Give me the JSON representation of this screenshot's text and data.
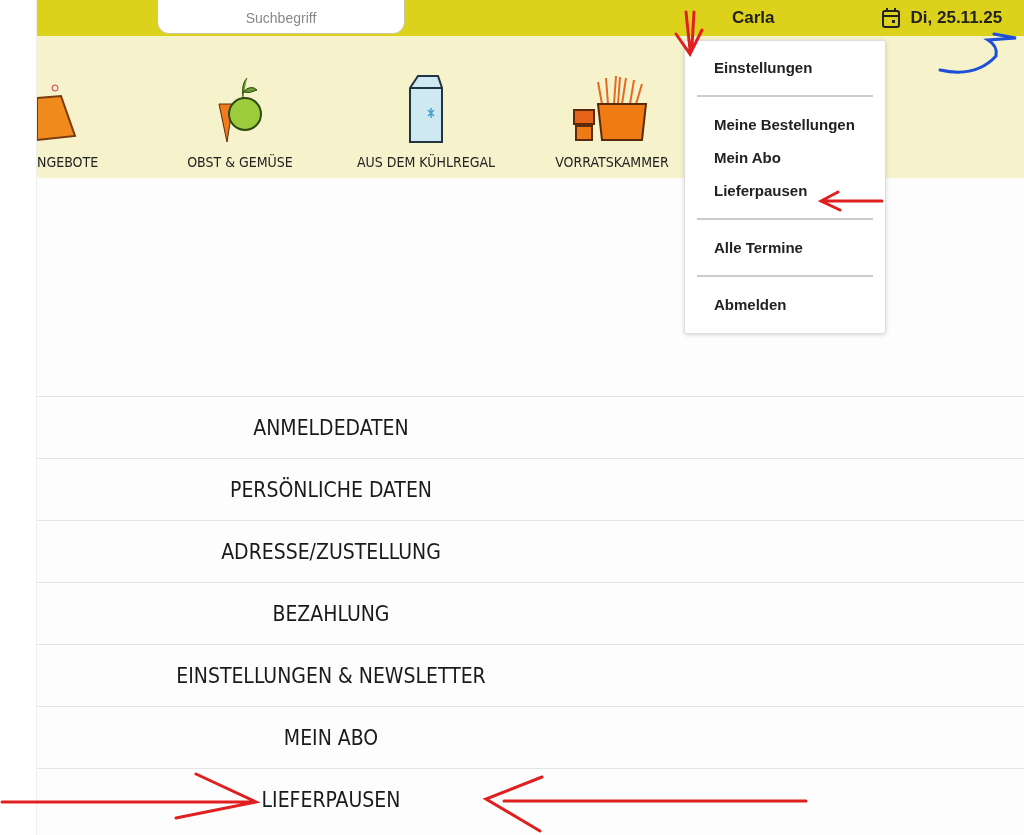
{
  "top_bar": {
    "search": {
      "placeholder": "Suchbegriff"
    },
    "user": "Carla",
    "date": "Di, 25.11.25"
  },
  "categories": [
    {
      "label": "NGEBOTE",
      "kind": "tag"
    },
    {
      "label": "OBST & GEMÜSE",
      "kind": "produce"
    },
    {
      "label": "AUS DEM KÜHLREGAL",
      "kind": "carton"
    },
    {
      "label": "VORRATSKAMMER",
      "kind": "pot"
    }
  ],
  "user_menu": {
    "groups": [
      {
        "items": [
          "Einstellungen"
        ]
      },
      {
        "items": [
          "Meine Bestellungen",
          "Mein Abo",
          "Lieferpausen"
        ]
      },
      {
        "items": [
          "Alle Termine"
        ]
      },
      {
        "items": [
          "Abmelden"
        ]
      }
    ]
  },
  "account_sections": [
    "ANMELDEDATEN",
    "PERSÖNLICHE DATEN",
    "ADRESSE/ZUSTELLUNG",
    "BEZAHLUNG",
    "EINSTELLUNGEN & NEWSLETTER",
    "MEIN ABO",
    "LIEFERPAUSEN"
  ]
}
